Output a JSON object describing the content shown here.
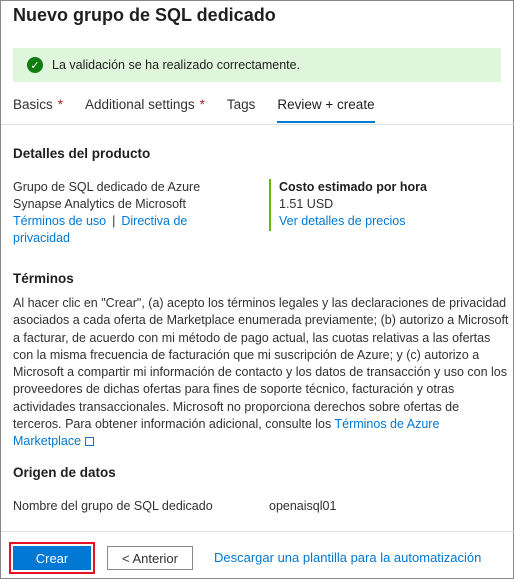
{
  "title": "Nuevo grupo de SQL dedicado",
  "validation": {
    "message": "La validación se ha realizado correctamente.",
    "icon": "checkmark-icon",
    "color": "#107c10"
  },
  "tabs": [
    {
      "label": "Basics",
      "required": "*"
    },
    {
      "label": "Additional settings",
      "required": "*"
    },
    {
      "label": "Tags",
      "required": ""
    },
    {
      "label": "Review + create",
      "required": ""
    }
  ],
  "product": {
    "heading": "Detalles del producto",
    "name_line1": "Grupo de SQL dedicado de Azure",
    "name_line2": "Synapse Analytics de Microsoft",
    "terms_link": "Términos de uso",
    "separator": "|",
    "privacy_link_1": "Directiva de",
    "privacy_link_2": "privacidad",
    "cost_label": "Costo estimado por hora",
    "cost_value": "1.51 USD",
    "pricing_link": "Ver detalles de precios"
  },
  "terms": {
    "heading": "Términos",
    "body": "Al hacer clic en \"Crear\", (a) acepto los términos legales y las declaraciones de privacidad asociados a cada oferta de Marketplace enumerada previamente; (b) autorizo a Microsoft a facturar, de acuerdo con mi método de pago actual, las cuotas relativas a las ofertas con la misma frecuencia de facturación que mi suscripción de Azure; y (c) autorizo a Microsoft a compartir mi información de contacto y los datos de transacción y uso con los proveedores de dichas ofertas para fines de soporte técnico, facturación y otras actividades transaccionales. Microsoft no proporciona derechos sobre ofertas de terceros. Para obtener información adicional, consulte los",
    "link": "Términos de Azure Marketplace"
  },
  "origin": {
    "heading": "Origen de datos",
    "field_label": "Nombre del grupo de SQL dedicado",
    "field_value": "openaisql01"
  },
  "footer": {
    "create_label": "Crear",
    "previous_label": "< Anterior",
    "template_link": "Descargar una plantilla para la automatización"
  }
}
